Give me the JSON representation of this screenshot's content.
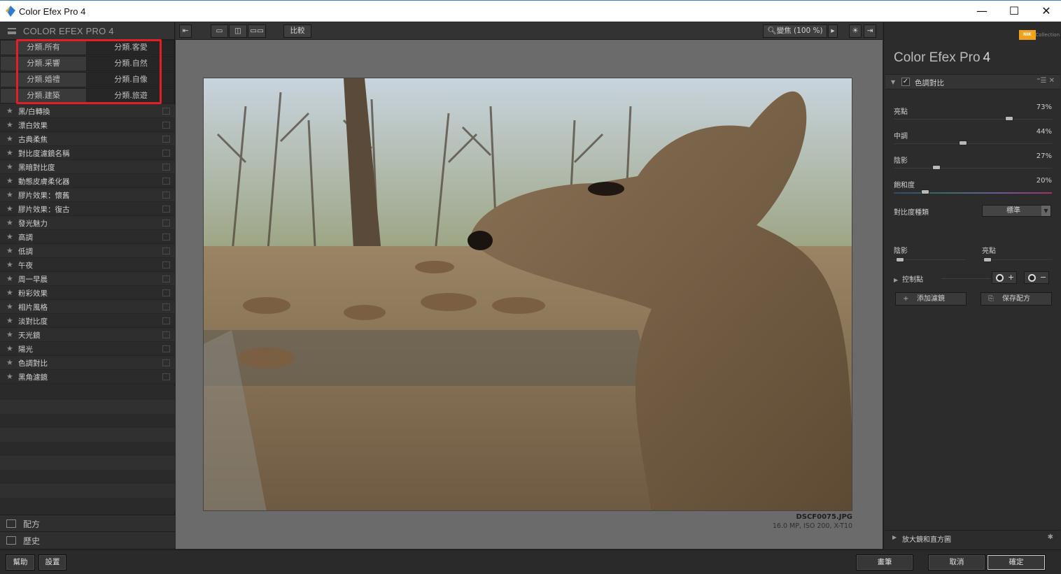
{
  "window": {
    "title": "Color Efex Pro 4",
    "minimize": "—",
    "maximize": "☐",
    "close": "✕"
  },
  "left_panel": {
    "title": "COLOR EFEX PRO 4",
    "categories": [
      {
        "left": "分類.所有",
        "right": "分類.客愛"
      },
      {
        "left": "分類.采響",
        "right": "分類.自然"
      },
      {
        "left": "分類.婚禮",
        "right": "分類.自像"
      },
      {
        "left": "分類.建築",
        "right": "分類.旅遊"
      }
    ],
    "filters": [
      "黑/白轉換",
      "漂白效果",
      "古典柔焦",
      "對比度濾鏡名稱",
      "黑暗對比度",
      "動態皮膚柔化器",
      "膠片效果：懷舊",
      "膠片效果：復古",
      "發光魅力",
      "高調",
      "低調",
      "午夜",
      "周一早晨",
      "粉彩效果",
      "相片風格",
      "淡對比度",
      "天光鏡",
      "陽光",
      "色調對比",
      "黑角濾鏡"
    ],
    "bottom": [
      {
        "icon": "recipe-icon",
        "label": "配方"
      },
      {
        "icon": "history-icon",
        "label": "歷史"
      }
    ]
  },
  "toolbar": {
    "compare": "比較",
    "zoom": "變焦 (100 %)",
    "zoom_arrow": "▸"
  },
  "image": {
    "filename": "DSCF0075.JPG",
    "info": "16.0 MP, ISO 200, X-T10"
  },
  "right_panel": {
    "logo": "NIK",
    "collection": "Collection",
    "brand": "Color Efex Pro",
    "brand_num": "4",
    "filter_name": "色調對比",
    "filter_tools": "⁼☰ ✕",
    "sliders": [
      {
        "label": "亮點",
        "value": "73%",
        "fraction": 0.73
      },
      {
        "label": "中調",
        "value": "44%",
        "fraction": 0.44
      },
      {
        "label": "陰影",
        "value": "27%",
        "fraction": 0.27
      },
      {
        "label": "飽和度",
        "value": "20%",
        "fraction": 0.2
      }
    ],
    "contrast_type_label": "對比度種類",
    "contrast_type_value": "標準",
    "mini_left": "陰影",
    "mini_right": "亮點",
    "control_points": "控制點",
    "add_filter": "添加濾鏡",
    "save_recipe": "保存配方",
    "footer": "放大鏡和直方圖"
  },
  "bottom_bar": {
    "help": "幫助",
    "settings": "設置",
    "brush": "畫筆",
    "cancel": "取消",
    "ok": "確定"
  }
}
